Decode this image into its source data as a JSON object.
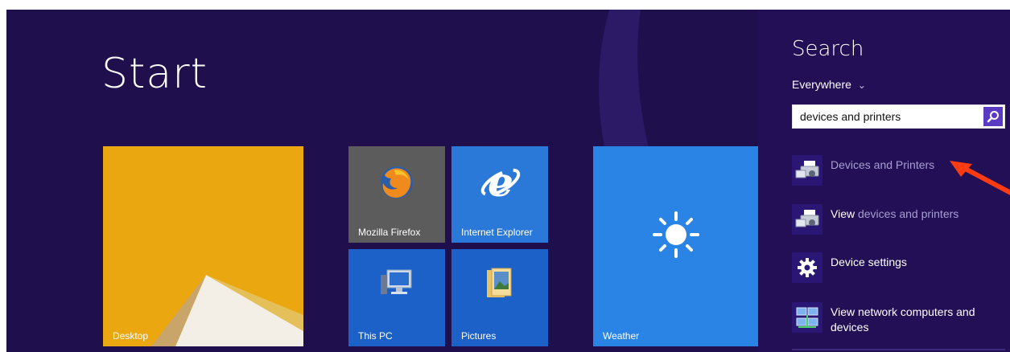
{
  "start": {
    "title": "Start"
  },
  "tiles": {
    "desktop": "Desktop",
    "firefox": "Mozilla Firefox",
    "ie": "Internet Explorer",
    "this_pc": "This PC",
    "pictures": "Pictures",
    "weather": "Weather"
  },
  "search": {
    "title": "Search",
    "scope": "Everywhere",
    "query": "devices and printers",
    "results": [
      {
        "label": "Devices and Printers",
        "icon": "devices-printers-icon"
      },
      {
        "label_prefix": "View",
        "label_dim": " devices and printers",
        "icon": "devices-printers-icon"
      },
      {
        "label": "Device settings",
        "icon": "gear-icon"
      },
      {
        "label_line1": "View network computers and",
        "label_line2": "devices",
        "icon": "network-computers-icon"
      }
    ]
  },
  "colors": {
    "background": "#1f0f4c",
    "search_pane": "#220f55",
    "accent": "#5b3ac3",
    "arrow": "#ff3b12"
  }
}
